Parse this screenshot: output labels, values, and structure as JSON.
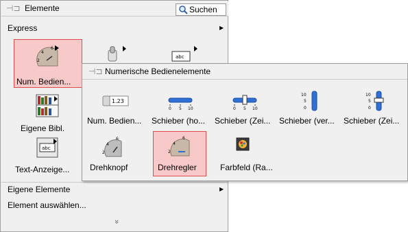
{
  "palette": {
    "title": "Elemente",
    "search_label": "Suchen",
    "express_label": "Express",
    "tiles_row1": [
      {
        "label": "Num. Bedien..."
      }
    ],
    "tiles_left": [
      {
        "label": "Eigene Bibl."
      },
      {
        "label": "Text-Anzeige..."
      }
    ],
    "bottom_items": [
      {
        "label": "Eigene Elemente"
      },
      {
        "label": "Element auswählen..."
      }
    ],
    "more_glyph": "»",
    "text_icon_label": "abc"
  },
  "subpalette": {
    "title": "Numerische Bedienelemente",
    "row1": [
      {
        "label": "Num. Bedien...",
        "icon": "numeric-control-icon",
        "value": "1.23"
      },
      {
        "label": "Schieber (ho...",
        "icon": "horizontal-slider-icon"
      },
      {
        "label": "Schieber (Zei...",
        "icon": "horizontal-pointer-slider-icon"
      },
      {
        "label": "Schieber (ver...",
        "icon": "vertical-slider-icon"
      },
      {
        "label": "Schieber (Zei...",
        "icon": "vertical-pointer-slider-icon"
      }
    ],
    "row2": [
      {
        "label": "Drehknopf",
        "icon": "knob-icon"
      },
      {
        "label": "Drehregler",
        "icon": "dial-icon",
        "selected": true
      },
      {
        "label": "Farbfeld (Ra...",
        "icon": "color-box-icon"
      }
    ],
    "scale_h": [
      "0",
      "5",
      "10"
    ],
    "scale_v": [
      "10",
      "5",
      "0"
    ],
    "dial_ticks": [
      "4",
      "6",
      "2"
    ]
  },
  "colors": {
    "selection_fill": "#f7c9c9",
    "selection_border": "#e04b4b",
    "slider_blue": "#2f6fd6"
  }
}
